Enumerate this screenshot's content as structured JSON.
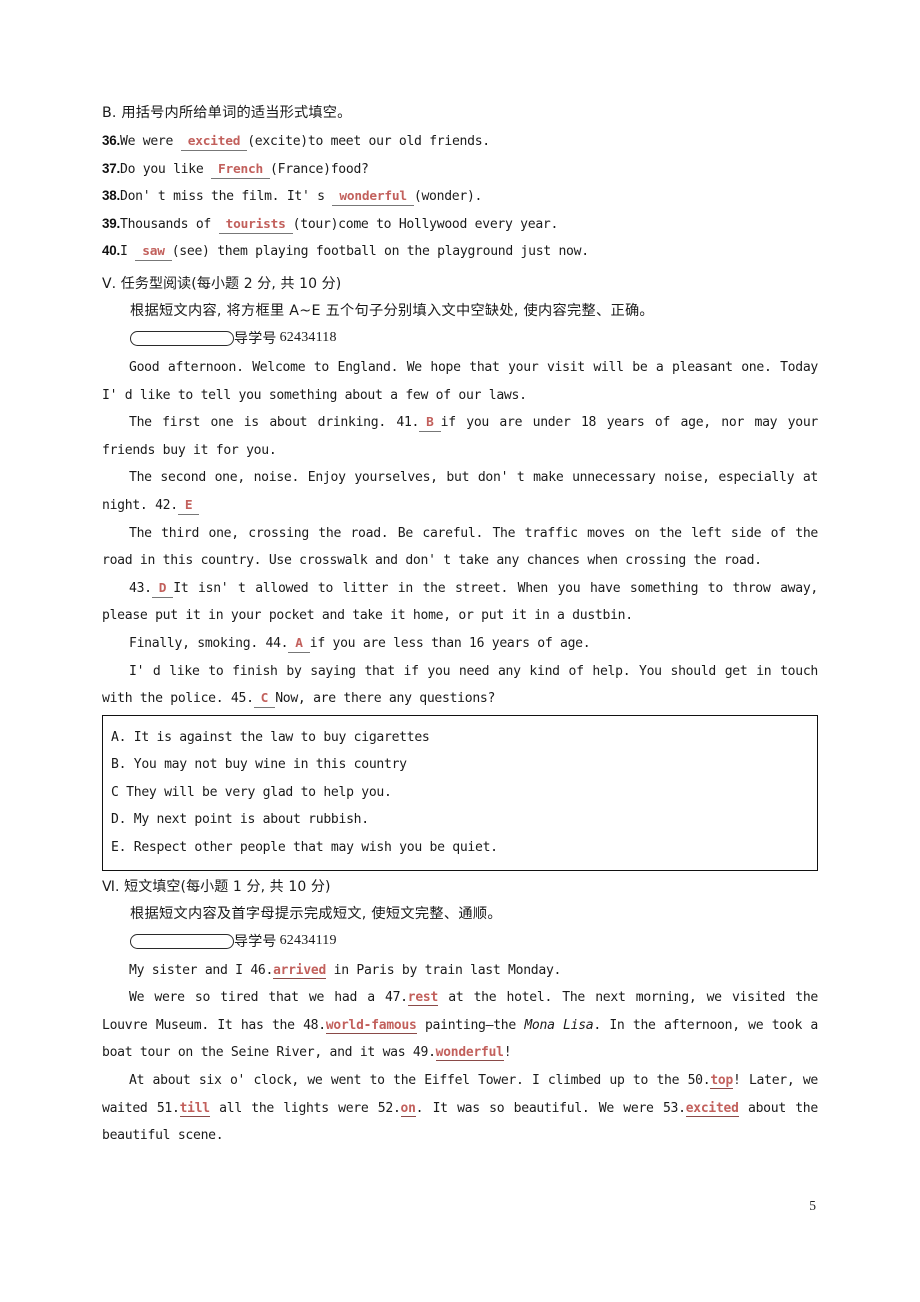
{
  "page": {
    "number": "5"
  },
  "part_b": {
    "heading": "B. 用括号内所给单词的适当形式填空。",
    "items": [
      {
        "num": "36.",
        "pre": "We were ",
        "answer": "excited",
        "post": "(excite)to meet our old friends."
      },
      {
        "num": "37.",
        "pre": "Do you like ",
        "answer": "French",
        "post": "(France)food?"
      },
      {
        "num": "38.",
        "pre": "Don' t miss the film. It' s ",
        "answer": "wonderful",
        "post": "(wonder)."
      },
      {
        "num": "39.",
        "pre": "Thousands of ",
        "answer": "tourists",
        "post": "(tour)come to Hollywood every year."
      },
      {
        "num": "40.",
        "pre": "I ",
        "answer": "saw",
        "post": "(see) them playing football on the playground just now."
      }
    ]
  },
  "section_v": {
    "heading": "Ⅴ. 任务型阅读(每小题 2 分, 共 10 分)",
    "instruction": "根据短文内容, 将方框里 A~E 五个句子分别填入文中空缺处, 使内容完整、正确。",
    "daoxue_label": "导学号",
    "daoxue_number": "62434118",
    "passage": [
      {
        "indent": true,
        "segments": [
          {
            "type": "text",
            "value": "Good afternoon. Welcome to England. We hope that your visit will be a pleasant one. Today I' d like to tell you something about a few of our laws."
          }
        ]
      },
      {
        "indent": true,
        "segments": [
          {
            "type": "text",
            "value": "The first one is about drinking. 41."
          },
          {
            "type": "answer",
            "value": "B"
          },
          {
            "type": "text",
            "value": "if you are under 18 years of age, nor may your friends buy it for you."
          }
        ]
      },
      {
        "indent": true,
        "segments": [
          {
            "type": "text",
            "value": "The second one, noise. Enjoy yourselves, but don' t make unnecessary noise, especially at night. 42."
          },
          {
            "type": "answer",
            "value": "E"
          }
        ]
      },
      {
        "indent": true,
        "segments": [
          {
            "type": "text",
            "value": "The third one, crossing the road. Be careful. The traffic moves on the left side of the road in this country. Use crosswalk and don' t take any chances when crossing the road."
          }
        ]
      },
      {
        "indent": true,
        "segments": [
          {
            "type": "text",
            "value": "43."
          },
          {
            "type": "answer",
            "value": "D"
          },
          {
            "type": "text",
            "value": "It isn' t allowed to litter in the street. When you have something to throw away, please put it in your pocket and take it home, or put it in a dustbin."
          }
        ]
      },
      {
        "indent": true,
        "segments": [
          {
            "type": "text",
            "value": "Finally, smoking. 44."
          },
          {
            "type": "answer",
            "value": "A"
          },
          {
            "type": "text",
            "value": "if you are less than 16 years of age."
          }
        ]
      },
      {
        "indent": true,
        "segments": [
          {
            "type": "text",
            "value": "I' d like to finish by saying that if you need any kind of help. You should get in touch with the police. 45."
          },
          {
            "type": "answer",
            "value": "C"
          },
          {
            "type": "text",
            "value": "Now, are there any questions?"
          }
        ]
      }
    ],
    "options": [
      "A. It is against the law to buy cigarettes",
      "B. You may not buy wine in this country",
      "C They will be very glad to help you.",
      "D. My next point is about rubbish.",
      "E. Respect other people that may wish you be quiet."
    ]
  },
  "section_vi": {
    "heading": "Ⅵ. 短文填空(每小题 1 分, 共 10 分)",
    "instruction": "根据短文内容及首字母提示完成短文, 使短文完整、通顺。",
    "daoxue_label": "导学号",
    "daoxue_number": "62434119",
    "passage": [
      {
        "indent": true,
        "segments": [
          {
            "type": "text",
            "value": "My sister and I 46."
          },
          {
            "type": "answer-underline",
            "value": "arrived"
          },
          {
            "type": "text",
            "value": " in Paris by train last Monday."
          }
        ]
      },
      {
        "indent": true,
        "segments": [
          {
            "type": "text",
            "value": "We were so tired that we had a 47."
          },
          {
            "type": "answer-underline",
            "value": "rest"
          },
          {
            "type": "text",
            "value": " at the hotel. The next morning, we visited the Louvre Museum. It has the 48."
          },
          {
            "type": "answer-underline",
            "value": "world-famous"
          },
          {
            "type": "text",
            "value": " painting—the "
          },
          {
            "type": "italic",
            "value": "Mona Lisa"
          },
          {
            "type": "text",
            "value": ". In the afternoon, we took a boat tour on the Seine River, and it was 49."
          },
          {
            "type": "answer-underline",
            "value": "wonderful"
          },
          {
            "type": "text",
            "value": "!"
          }
        ]
      },
      {
        "indent": true,
        "segments": [
          {
            "type": "text",
            "value": "At about six o' clock, we went to the Eiffel Tower. I climbed up to the 50."
          },
          {
            "type": "answer-underline",
            "value": "top"
          },
          {
            "type": "text",
            "value": "! Later, we waited 51."
          },
          {
            "type": "answer-underline",
            "value": "till"
          },
          {
            "type": "text",
            "value": " all the lights were 52."
          },
          {
            "type": "answer-underline",
            "value": "on"
          },
          {
            "type": "text",
            "value": ". It was so beautiful. We were 53."
          },
          {
            "type": "answer-underline",
            "value": "excited"
          },
          {
            "type": "text",
            "value": " about the beautiful scene."
          }
        ]
      }
    ]
  },
  "colors": {
    "answer_red": "#c2605c",
    "text_black": "#1a1a1a",
    "rule": "#777777"
  }
}
